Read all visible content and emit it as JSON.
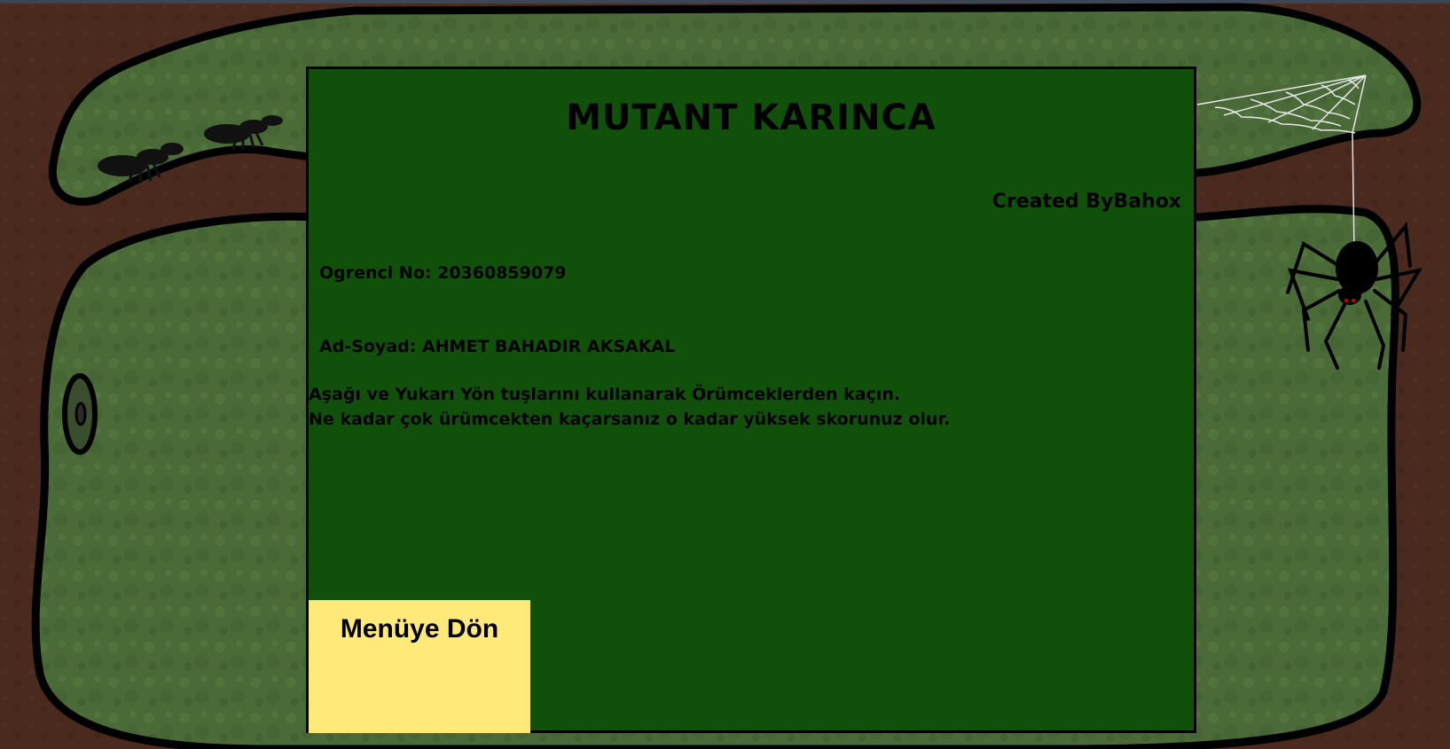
{
  "game": {
    "title": "MUTANT KARINCA",
    "credit": "Created ByBahox",
    "student_no": "Ogrenci No: 20360859079",
    "full_name": "Ad-Soyad: AHMET BAHADIR AKSAKAL",
    "instructions": [
      "Aşağı ve Yukarı Yön tuşlarını kullanarak Örümceklerden kaçın.",
      "Ne kadar çok ürümcekten kaçarsanız o kadar yüksek skorunuz olur."
    ],
    "menu_button_label": "Menüye Dön"
  },
  "colors": {
    "panel_background": "#10500b",
    "button_background": "#ffe978",
    "grass": "#4a6b38",
    "dirt": "#4a2a1e"
  },
  "icons": [
    "ant-icon",
    "spider-icon",
    "spider-web-icon",
    "hole-icon"
  ]
}
